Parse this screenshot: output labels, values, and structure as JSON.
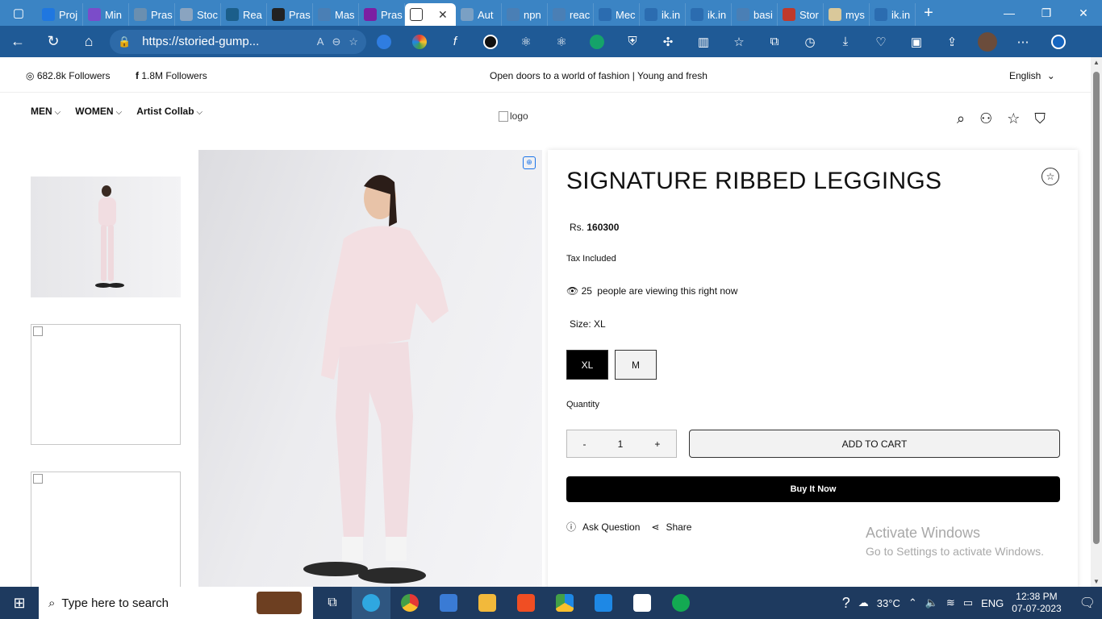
{
  "browser": {
    "tabs": [
      {
        "label": "Proj",
        "color": "#1f77e0"
      },
      {
        "label": "Min",
        "color": "#7b4cc9"
      },
      {
        "label": "Pras",
        "color": "#6a8fb0"
      },
      {
        "label": "Stoc",
        "color": "#8aa4c0"
      },
      {
        "label": "Rea",
        "color": "#1b5e8a"
      },
      {
        "label": "Pras",
        "color": "#222222"
      },
      {
        "label": "Mas",
        "color": "#4a7fb5"
      },
      {
        "label": "Pras",
        "color": "#7c1fa2"
      },
      {
        "label": "",
        "color": "#ffffff",
        "active": true
      },
      {
        "label": "Aut",
        "color": "#7aa0c4"
      },
      {
        "label": "npn",
        "color": "#4a7fb5"
      },
      {
        "label": "reac",
        "color": "#4a7fb5"
      },
      {
        "label": "Mec",
        "color": "#2b6cb0"
      },
      {
        "label": "ik.in",
        "color": "#2b6cb0"
      },
      {
        "label": "ik.in",
        "color": "#2b6cb0"
      },
      {
        "label": "basi",
        "color": "#4a7fb5"
      },
      {
        "label": "Stor",
        "color": "#c0392b"
      },
      {
        "label": "mys",
        "color": "#d9c89a"
      },
      {
        "label": "ik.in",
        "color": "#2b6cb0"
      }
    ],
    "url": "https://storied-gump...",
    "tab_close": "✕",
    "new_tab": "+"
  },
  "announce": {
    "instagram": "682.8k Followers",
    "facebook": "1.8M Followers",
    "message": "Open doors to a world of fashion | Young and fresh",
    "language": "English"
  },
  "nav": {
    "items": [
      "MEN",
      "WOMEN",
      "Artist Collab"
    ],
    "logo_alt": "logo"
  },
  "product": {
    "title": "SIGNATURE RIBBED LEGGINGS",
    "price_prefix": "Rs.",
    "price": "160300",
    "tax": "Tax Included",
    "viewers": "25",
    "viewing_text": "people are viewing this right now",
    "size_label": "Size: XL",
    "sizes": [
      "XL",
      "M"
    ],
    "quantity_label": "Quantity",
    "qty_minus": "-",
    "qty_value": "1",
    "qty_plus": "+",
    "add_to_cart": "ADD TO CART",
    "buy_now": "Buy It Now",
    "ask_question": "Ask Question",
    "share": "Share"
  },
  "watermark": {
    "line1": "Activate Windows",
    "line2": "Go to Settings to activate Windows."
  },
  "taskbar": {
    "search_placeholder": "Type here to search",
    "weather": "33°C",
    "lang": "ENG",
    "time": "12:38 PM",
    "date": "07-07-2023"
  }
}
